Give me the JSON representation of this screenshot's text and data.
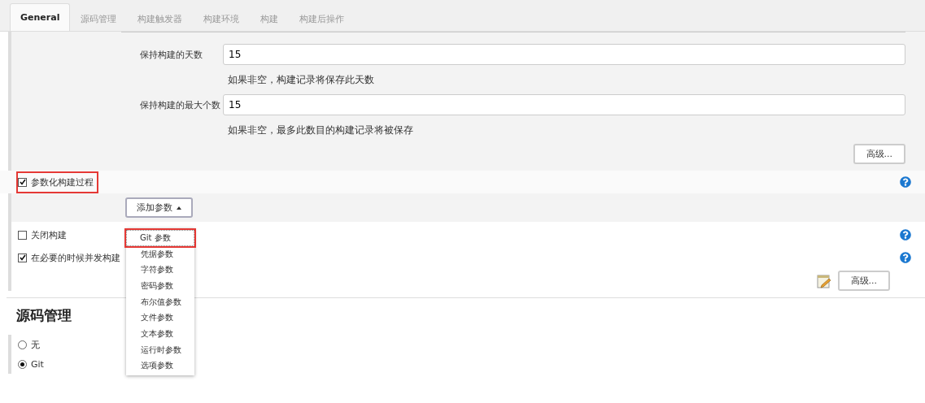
{
  "tabs": [
    {
      "label": "General",
      "selected": true
    },
    {
      "label": "源码管理",
      "selected": false
    },
    {
      "label": "构建触发器",
      "selected": false
    },
    {
      "label": "构建环境",
      "selected": false
    },
    {
      "label": "构建",
      "selected": false
    },
    {
      "label": "构建后操作",
      "selected": false
    }
  ],
  "discard": {
    "fields": [
      {
        "label": "保持构建的天数",
        "value": "15",
        "help": "如果非空，构建记录将保存此天数"
      },
      {
        "label": "保持构建的最大个数",
        "value": "15",
        "help": "如果非空，最多此数目的构建记录将被保存"
      }
    ],
    "advanced": "高级..."
  },
  "parameterized": {
    "label": "参数化构建过程",
    "checked": true,
    "highlighted": true
  },
  "add_param": {
    "label": "添加参数",
    "expanded": true,
    "menu": [
      {
        "label": "Git 参数",
        "highlighted": true
      },
      {
        "label": "凭据参数",
        "highlighted": false
      },
      {
        "label": "字符参数",
        "highlighted": false
      },
      {
        "label": "密码参数",
        "highlighted": false
      },
      {
        "label": "布尔值参数",
        "highlighted": false
      },
      {
        "label": "文件参数",
        "highlighted": false
      },
      {
        "label": "文本参数",
        "highlighted": false
      },
      {
        "label": "运行时参数",
        "highlighted": false
      },
      {
        "label": "选项参数",
        "highlighted": false
      }
    ]
  },
  "options": [
    {
      "label": "关闭构建",
      "checked": false
    },
    {
      "label": "在必要的时候并发构建",
      "checked": true
    }
  ],
  "advanced": "高级...",
  "scm": {
    "title": "源码管理",
    "choices": [
      {
        "label": "无",
        "selected": false
      },
      {
        "label": "Git",
        "selected": true
      }
    ]
  }
}
